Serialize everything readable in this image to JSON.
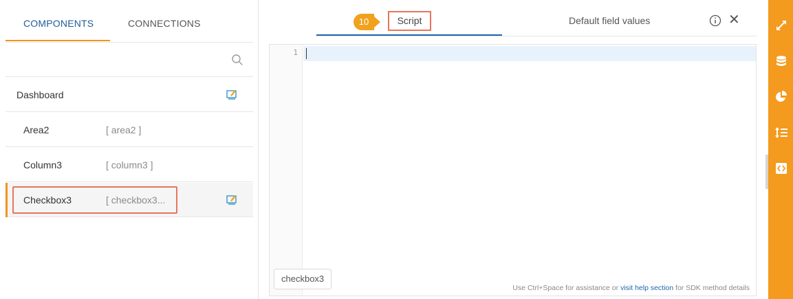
{
  "left_tabs": {
    "active": "COMPONENTS",
    "inactive": "CONNECTIONS"
  },
  "components": {
    "parent": {
      "name": "Dashboard"
    },
    "items": [
      {
        "name": "Area2",
        "alias": "[ area2 ]"
      },
      {
        "name": "Column3",
        "alias": "[ column3 ]"
      },
      {
        "name": "Checkbox3",
        "alias": "[ checkbox3..."
      }
    ]
  },
  "editor": {
    "step_badge": "10",
    "tab_script": "Script",
    "tab_default": "Default field values",
    "line_number": "1",
    "component_chip": "checkbox3",
    "help_prefix": "Use Ctrl+Space for assistance or ",
    "help_link": "visit help section",
    "help_suffix": " for SDK method details"
  },
  "colors": {
    "accent_orange": "#f49a1e",
    "highlight_red": "#e8745c",
    "link_blue": "#1f66b0"
  }
}
